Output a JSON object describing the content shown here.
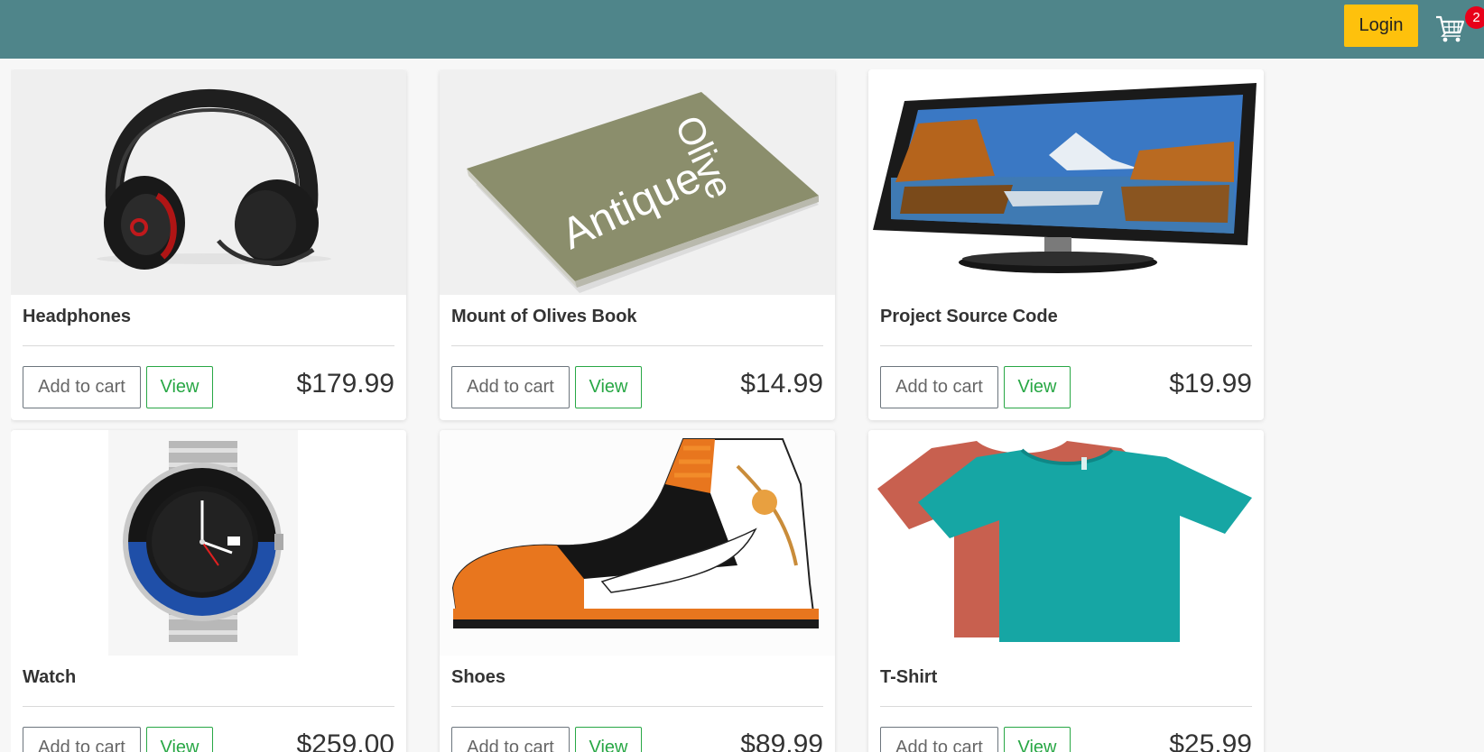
{
  "header": {
    "login_label": "Login",
    "cart_count": "2",
    "bar_color": "#4f858a",
    "login_color": "#fec10c"
  },
  "products": [
    {
      "name": "Headphones",
      "price": "$179.99",
      "add_label": "Add to cart",
      "view_label": "View",
      "image": "headphones-image"
    },
    {
      "name": "Mount of Olives Book",
      "price": "$14.99",
      "add_label": "Add to cart",
      "view_label": "View",
      "image": "book-image",
      "image_text": [
        "Antique",
        "Olive"
      ]
    },
    {
      "name": "Project Source Code",
      "price": "$19.99",
      "add_label": "Add to cart",
      "view_label": "View",
      "image": "monitor-image"
    },
    {
      "name": "Watch",
      "price": "$259.00",
      "add_label": "Add to cart",
      "view_label": "View",
      "image": "watch-image"
    },
    {
      "name": "Shoes",
      "price": "$89.99",
      "add_label": "Add to cart",
      "view_label": "View",
      "image": "shoe-image"
    },
    {
      "name": "T-Shirt",
      "price": "$25.99",
      "add_label": "Add to cart",
      "view_label": "View",
      "image": "tshirt-image"
    }
  ]
}
